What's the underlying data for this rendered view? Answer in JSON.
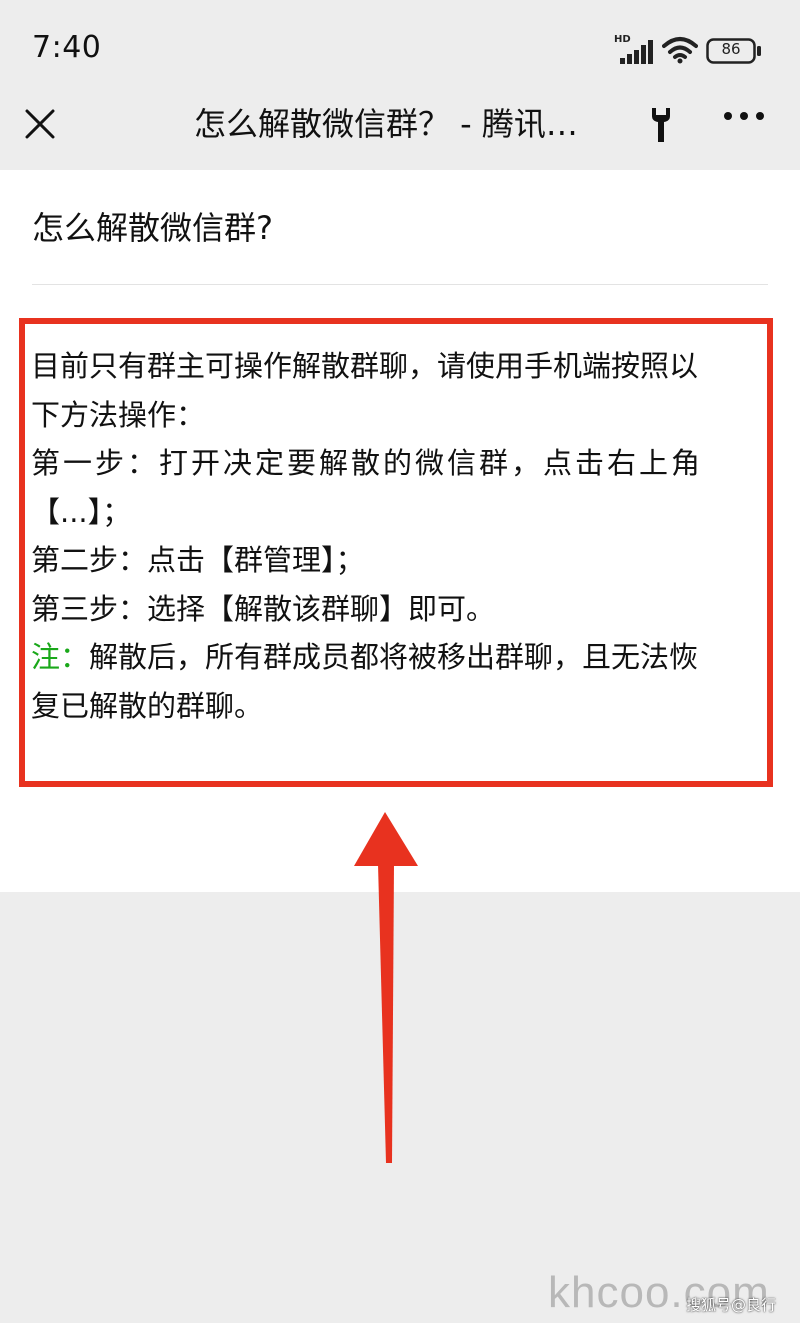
{
  "status_bar": {
    "time": "7:40",
    "network_label": "HD",
    "battery_level": "86",
    "icons": [
      "signal-icon",
      "wifi-icon",
      "battery-icon"
    ]
  },
  "nav": {
    "title": "怎么解散微信群？ - 腾讯…",
    "icons": [
      "close-icon",
      "wrench-icon",
      "more-icon"
    ]
  },
  "article": {
    "title": "怎么解散微信群?",
    "lines": [
      "目前只有群主可操作解散群聊，请使用手机端按照以",
      "下方法操作：",
      "第一步：打开决定要解散的微信群，点击右上角",
      "【...】；",
      "第二步：点击【群管理】；",
      "第三步：选择【解散该群聊】即可。"
    ],
    "note_label": "注：",
    "note_lines": [
      "解散后，所有群成员都将被移出群聊，且无法恢",
      "复已解散的群聊。"
    ]
  },
  "annotation": {
    "box_color": "#e8321f",
    "arrow_color": "#e8321f"
  },
  "watermark": {
    "site": "khcoo.com",
    "credit": "搜狐号@良行"
  },
  "colors": {
    "background": "#ededed",
    "content_background": "#ffffff",
    "note_green": "#1aa81a"
  }
}
